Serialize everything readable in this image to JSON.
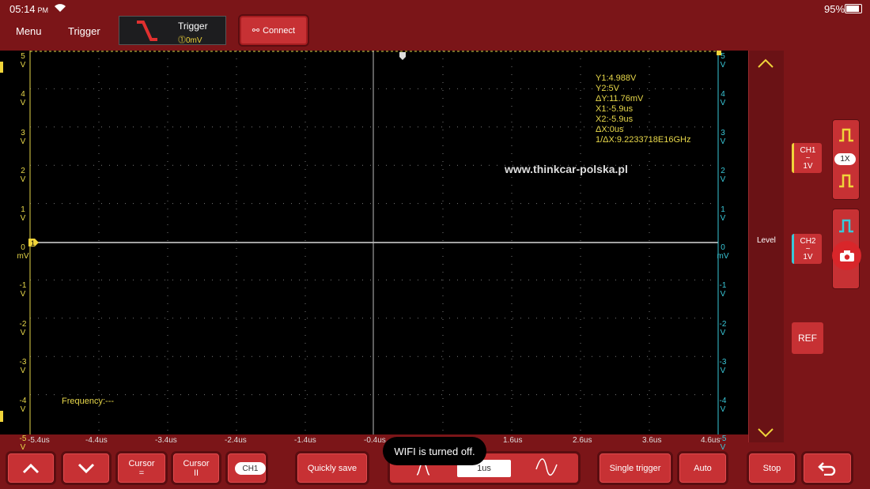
{
  "status_bar": {
    "time": "05:14",
    "ampm": "PM",
    "battery": "95%"
  },
  "top_bar": {
    "menu": "Menu",
    "trigger": "Trigger",
    "trigger_chip": {
      "title": "Trigger",
      "value": "0mV"
    },
    "connect": "Connect"
  },
  "scope": {
    "y_left": [
      {
        "value": "5",
        "unit": "V"
      },
      {
        "value": "4",
        "unit": "V"
      },
      {
        "value": "3",
        "unit": "V"
      },
      {
        "value": "2",
        "unit": "V"
      },
      {
        "value": "1",
        "unit": "V"
      },
      {
        "value": "0",
        "unit": "mV"
      },
      {
        "value": "-1",
        "unit": "V"
      },
      {
        "value": "-2",
        "unit": "V"
      },
      {
        "value": "-3",
        "unit": "V"
      },
      {
        "value": "-4",
        "unit": "V"
      },
      {
        "value": "-5",
        "unit": "V"
      }
    ],
    "y_right": [
      {
        "value": "5",
        "unit": "V"
      },
      {
        "value": "4",
        "unit": "V"
      },
      {
        "value": "3",
        "unit": "V"
      },
      {
        "value": "2",
        "unit": "V"
      },
      {
        "value": "1",
        "unit": "V"
      },
      {
        "value": "0",
        "unit": "mV"
      },
      {
        "value": "-1",
        "unit": "V"
      },
      {
        "value": "-2",
        "unit": "V"
      },
      {
        "value": "-3",
        "unit": "V"
      },
      {
        "value": "-4",
        "unit": "V"
      },
      {
        "value": "-5",
        "unit": "V"
      }
    ],
    "x_labels": [
      "-5.4us",
      "-4.4us",
      "-3.4us",
      "-2.4us",
      "-1.4us",
      "-0.4us",
      "1.6us",
      "2.6us",
      "3.6us",
      "4.6us"
    ],
    "cursor_info": [
      "Y1:4.988V",
      "Y2:5V",
      "ΔY:11.76mV",
      "X1:-5.9us",
      "X2:-5.9us",
      "ΔX:0us",
      "1/ΔX:9.2233718E16GHz"
    ],
    "watermark": "www.thinkcar-polska.pl",
    "frequency": "Frequency:---",
    "ch1_marker": "1",
    "colors": {
      "ch1": "#e8d84a",
      "ch2": "#39c8d8",
      "grid": "#7a7a7a"
    }
  },
  "right_panel": {
    "level": "Level",
    "ch1": {
      "name": "CH1",
      "coupling": "~",
      "scale": "1V"
    },
    "ch2": {
      "name": "CH2",
      "coupling": "~",
      "scale": "1V"
    },
    "ref": "REF",
    "probe": "1X"
  },
  "bottom_bar": {
    "cursor_h": {
      "label": "Cursor",
      "sym": "="
    },
    "cursor_v": {
      "label": "Cursor",
      "sym": "II"
    },
    "ch_toggle": "CH1",
    "quick_save": "Quickly save",
    "timebase": "1us",
    "single_trigger": "Single trigger",
    "auto": "Auto",
    "stop": "Stop"
  },
  "toast": "WIFI is turned off."
}
